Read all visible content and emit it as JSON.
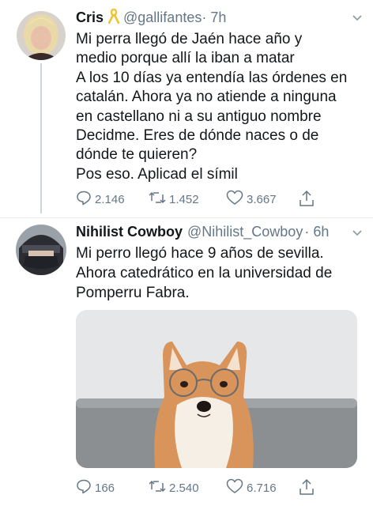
{
  "tweets": [
    {
      "name": "Cris",
      "handle": "@gallifantes",
      "time": "· 7h",
      "lines": [
        "Mi perra llegó de Jaén hace año y",
        "medio porque allí la iban a matar",
        "A los 10 días ya entendía las órdenes en",
        "catalán. Ahora ya no atiende a ninguna",
        "en castellano ni a su antiguo nombre",
        "Decidme. Eres de dónde naces o de",
        "dónde te quieren?",
        "Pos eso. Aplicad el símil"
      ],
      "replies": "2.146",
      "retweets": "1.452",
      "likes": "3.667"
    },
    {
      "name": "Nihilist Cowboy",
      "handle": "@Nihilist_Cowboy",
      "time": "· 6h",
      "lines": [
        "Mi perro llegó hace 9 años de sevilla.",
        "Ahora catedrático en la universidad de",
        "Pomperru Fabra."
      ],
      "replies": "166",
      "retweets": "2.540",
      "likes": "6.716"
    }
  ],
  "icons": {
    "reply": "reply-icon",
    "retweet": "retweet-icon",
    "like": "heart-icon",
    "share": "share-icon",
    "ribbon": "yellow-ribbon-icon",
    "caret": "chevron-down-icon"
  },
  "colors": {
    "text": "#14171a",
    "secondary": "#657786",
    "ribbon": "#f2c230",
    "thread_line": "#ccd6dd"
  }
}
